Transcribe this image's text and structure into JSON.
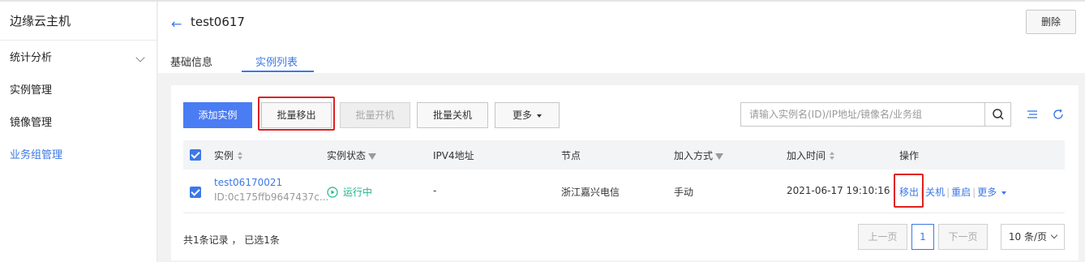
{
  "sidebar": {
    "title": "边缘云主机",
    "items": [
      {
        "label": "统计分析"
      },
      {
        "label": "实例管理"
      },
      {
        "label": "镜像管理"
      },
      {
        "label": "业务组管理"
      }
    ]
  },
  "header": {
    "back_icon": "←",
    "title": "test0617",
    "delete_label": "删除",
    "tabs": [
      {
        "label": "基础信息"
      },
      {
        "label": "实例列表"
      }
    ]
  },
  "toolbar": {
    "add_label": "添加实例",
    "batch_remove_label": "批量移出",
    "batch_start_label": "批量开机",
    "batch_stop_label": "批量关机",
    "more_label": "更多",
    "search_placeholder": "请输入实例名(ID)/IP地址/镜像名/业务组"
  },
  "table": {
    "columns": [
      "实例",
      "实例状态",
      "IPV4地址",
      "节点",
      "加入方式",
      "加入时间",
      "操作"
    ],
    "rows": [
      {
        "name": "test06170021",
        "id": "ID:0c175ffb9647437c...",
        "status": "运行中",
        "ipv4": "-",
        "node": "浙江嘉兴电信",
        "join_method": "手动",
        "join_time": "2021-06-17 19:10:16",
        "actions": [
          "移出",
          "关机",
          "重启",
          "更多"
        ]
      }
    ]
  },
  "footer": {
    "summary": "共1条记录 ， 已选1条",
    "prev_label": "上一页",
    "page": "1",
    "next_label": "下一页",
    "page_size": "10 条/页"
  },
  "colors": {
    "accent": "#3c78e6",
    "primary_button": "#4a7cf3",
    "status_running": "#21b48c",
    "highlight_box": "#e02020"
  }
}
